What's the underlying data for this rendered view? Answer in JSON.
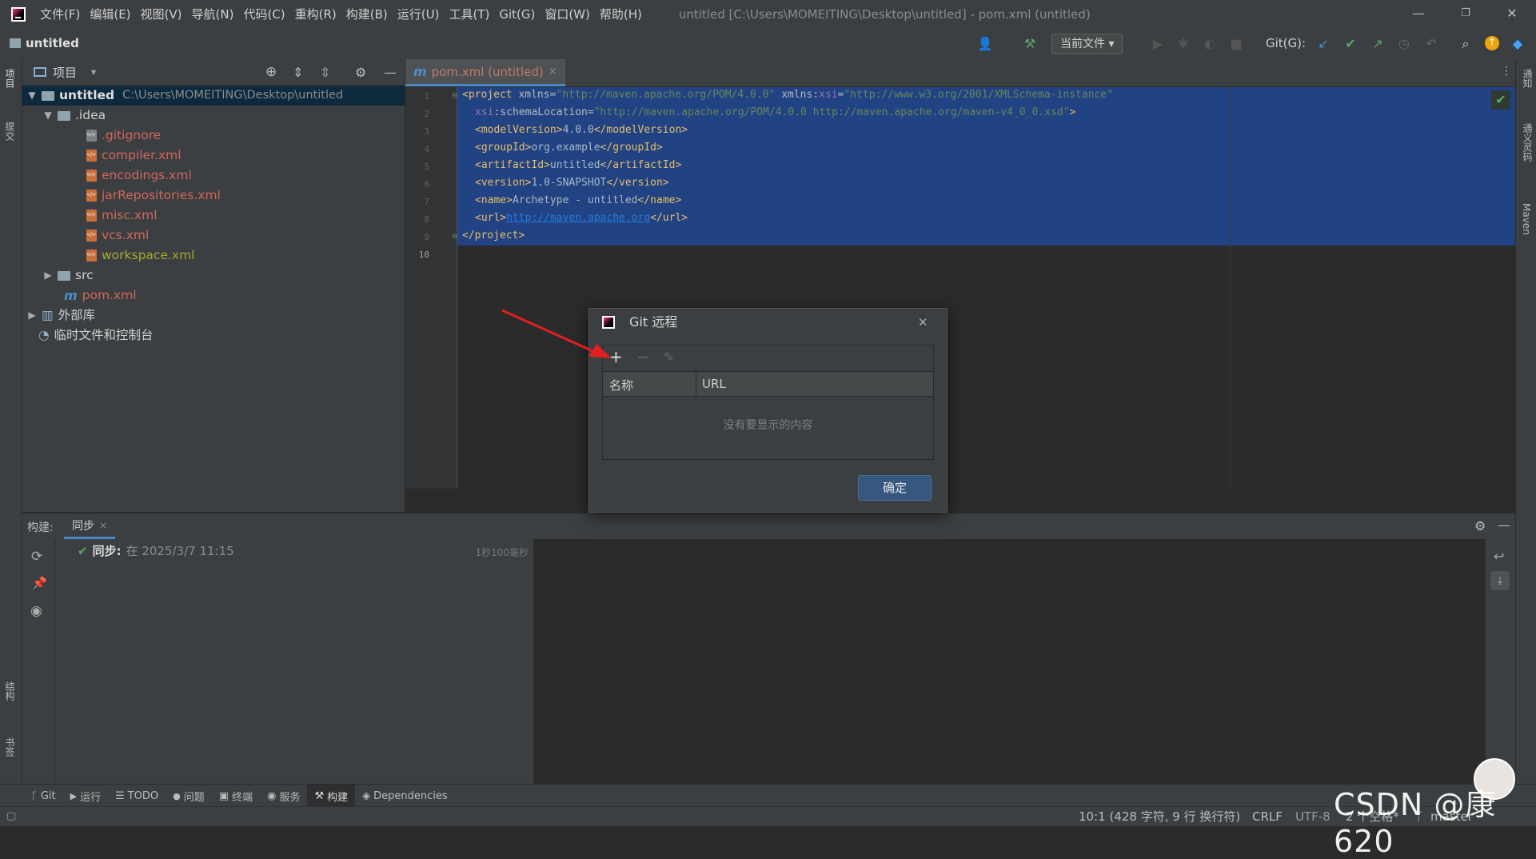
{
  "window": {
    "menu": [
      "文件(F)",
      "编辑(E)",
      "视图(V)",
      "导航(N)",
      "代码(C)",
      "重构(R)",
      "构建(B)",
      "运行(U)",
      "工具(T)",
      "Git(G)",
      "窗口(W)",
      "帮助(H)"
    ],
    "title": "untitled [C:\\Users\\MOMEITING\\Desktop\\untitled] - pom.xml (untitled)",
    "controls": {
      "minimize": "—",
      "restore": "❐",
      "close": "✕"
    }
  },
  "toolbar": {
    "project_name": "untitled",
    "run_config": "当前文件",
    "git_label": "Git(G):"
  },
  "left_strip": {
    "project": "项目",
    "commit": "提交",
    "structure": "结构",
    "bookmarks": "书签"
  },
  "right_strip": {
    "notifications": "通知",
    "ai": "通义灵码",
    "maven": "Maven"
  },
  "project_panel": {
    "title": "项目",
    "tree": [
      {
        "label": "untitled",
        "path": "C:\\Users\\MOMEITING\\Desktop\\untitled"
      },
      {
        "label": ".idea"
      },
      {
        "label": ".gitignore"
      },
      {
        "label": "compiler.xml"
      },
      {
        "label": "encodings.xml"
      },
      {
        "label": "jarRepositories.xml"
      },
      {
        "label": "misc.xml"
      },
      {
        "label": "vcs.xml"
      },
      {
        "label": "workspace.xml"
      },
      {
        "label": "src"
      },
      {
        "label": "pom.xml"
      },
      {
        "label": "外部库"
      },
      {
        "label": "临时文件和控制台"
      }
    ],
    "colors": {
      "untracked": "#d1675a",
      "ignored": "#a8a832",
      "normal": "#bbbbbb"
    }
  },
  "editor": {
    "tab": {
      "icon": "m",
      "label": "pom.xml (untitled)",
      "close": "×"
    },
    "line_numbers": [
      "1",
      "2",
      "3",
      "4",
      "5",
      "6",
      "7",
      "8",
      "9",
      "10"
    ],
    "lines": {
      "l1": {
        "open": "<project ",
        "a1": "xmlns",
        "eq": "=",
        "v1": "\"http://maven.apache.org/POM/4.0.0\"",
        "sp": " ",
        "a2": "xmlns:",
        "ns": "xsi",
        "v2": "\"http://www.w3.org/2001/XMLSchema-instance\""
      },
      "l2": {
        "ns": "xsi",
        "a": ":schemaLocation",
        "eq": "=",
        "v": "\"http://maven.apache.org/POM/4.0.0 http://maven.apache.org/maven-v4_0_0.xsd\"",
        "close": ">"
      },
      "l3": {
        "open": "<modelVersion>",
        "text": "4.0.0",
        "close": "</modelVersion>"
      },
      "l4": {
        "open": "<groupId>",
        "text": "org.example",
        "close": "</groupId>"
      },
      "l5": {
        "open": "<artifactId>",
        "text": "untitled",
        "close": "</artifactId>"
      },
      "l6": {
        "open": "<version>",
        "text": "1.0-SNAPSHOT",
        "close": "</version>"
      },
      "l7": {
        "open": "<name>",
        "text": "Archetype - untitled",
        "close": "</name>"
      },
      "l8": {
        "open": "<url>",
        "text": "http://maven.apache.org",
        "close": "</url>"
      },
      "l9": {
        "close": "</project>"
      }
    }
  },
  "build_panel": {
    "label": "构建:",
    "tab": "同步",
    "entry": {
      "title": "同步:",
      "time": "在 2025/3/7 11:15",
      "duration": "1秒100毫秒"
    }
  },
  "dialog": {
    "title": "Git 远程",
    "add": "+",
    "remove": "−",
    "edit": "✎",
    "columns": [
      "名称",
      "URL"
    ],
    "empty_text": "没有要显示的内容",
    "ok_label": "确定"
  },
  "tool_windows": [
    {
      "icon": "ᚴ",
      "label": "Git"
    },
    {
      "icon": "▶",
      "label": "运行"
    },
    {
      "icon": "☰",
      "label": "TODO"
    },
    {
      "icon": "●",
      "label": "问题"
    },
    {
      "icon": "▣",
      "label": "终端"
    },
    {
      "icon": "◉",
      "label": "服务"
    },
    {
      "icon": "⚒",
      "label": "构建"
    },
    {
      "icon": "◈",
      "label": "Dependencies"
    }
  ],
  "status_bar": {
    "position": "10:1 (428 字符, 9 行 换行符)",
    "line_sep": "CRLF",
    "encoding": "UTF-8",
    "indent": "2 个空格*",
    "branch": "master"
  },
  "watermark": "CSDN @康620"
}
